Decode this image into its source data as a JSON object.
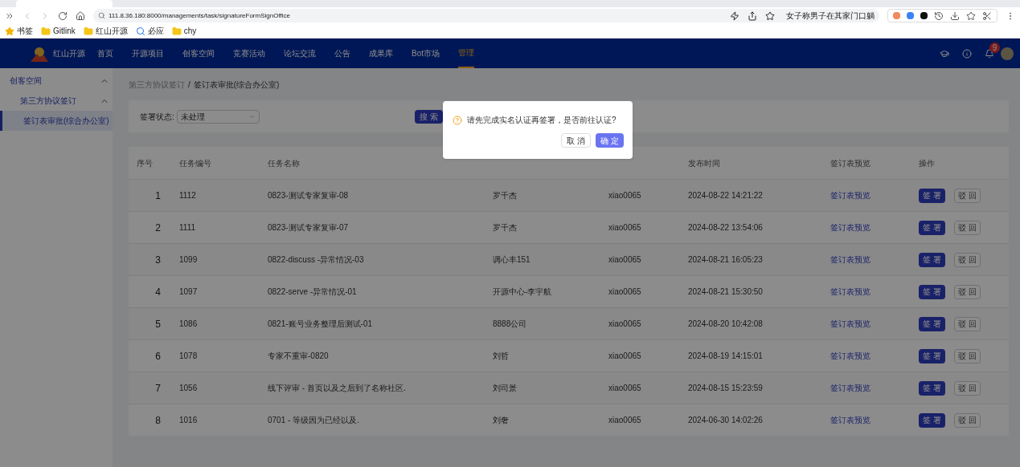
{
  "browser": {
    "url": "111.8.36.180:8000/managements/task/signatureFormSignOffice",
    "search_chip": "女子称男子在其家门口躺",
    "bookmarks": [
      {
        "label": "书签",
        "kind": "star"
      },
      {
        "label": "Gitlink",
        "kind": "folder"
      },
      {
        "label": "红山开源",
        "kind": "folder"
      },
      {
        "label": "必应",
        "kind": "search"
      },
      {
        "label": "chy",
        "kind": "folder"
      }
    ]
  },
  "nav": {
    "logo": "红山开源",
    "items": [
      {
        "label": "首页",
        "selected": false
      },
      {
        "label": "开源项目",
        "selected": false
      },
      {
        "label": "创客空间",
        "selected": false
      },
      {
        "label": "竞赛活动",
        "selected": false
      },
      {
        "label": "论坛交流",
        "selected": false
      },
      {
        "label": "公告",
        "selected": false
      },
      {
        "label": "成果库",
        "selected": false
      },
      {
        "label": "Bot市场",
        "selected": false
      },
      {
        "label": "管理",
        "selected": true
      }
    ],
    "badge": "9"
  },
  "sidebar": {
    "items": [
      {
        "label": "创客空间",
        "expanded": true,
        "children": [
          {
            "label": "第三方协议签订",
            "expanded": true,
            "children": [
              {
                "label": "签订表审批(综合办公室)",
                "selected": true
              }
            ]
          }
        ]
      }
    ]
  },
  "breadcrumb": {
    "parent": "第三方协议签订",
    "separator": "/",
    "current": "签订表审批(综合办公室)"
  },
  "filter": {
    "label": "签署状态:",
    "value": "未处理",
    "button": "搜 索"
  },
  "table": {
    "columns": [
      "序号",
      "任务编号",
      "任务名称",
      "",
      "",
      "发布时间",
      "签订表预览",
      "操作"
    ],
    "rows": [
      {
        "index": "1",
        "id": "1112",
        "name": "0823-测试专家复审-08",
        "owner": "罗千杰",
        "publisher": "xiao0065",
        "time": "2024-08-22 14:21:22",
        "preview": "签订表预览",
        "sign": "签 署",
        "reject": "驳 回"
      },
      {
        "index": "2",
        "id": "1111",
        "name": "0823-测试专家复审-07",
        "owner": "罗千杰",
        "publisher": "xiao0065",
        "time": "2024-08-22 13:54:06",
        "preview": "签订表预览",
        "sign": "签 署",
        "reject": "驳 回"
      },
      {
        "index": "3",
        "id": "1099",
        "name": "0822-discuss -异常情况-03",
        "owner": "调心丰151",
        "publisher": "xiao0065",
        "time": "2024-08-21 16:05:23",
        "preview": "签订表预览",
        "sign": "签 署",
        "reject": "驳 回"
      },
      {
        "index": "4",
        "id": "1097",
        "name": "0822-serve -异常情况-01",
        "owner": "开源中心-李宇航",
        "publisher": "xiao0065",
        "time": "2024-08-21 15:30:50",
        "preview": "签订表预览",
        "sign": "签 署",
        "reject": "驳 回"
      },
      {
        "index": "5",
        "id": "1086",
        "name": "0821-账号业务整理后测试-01",
        "owner": "8888公司",
        "publisher": "xiao0065",
        "time": "2024-08-20 10:42:08",
        "preview": "签订表预览",
        "sign": "签 署",
        "reject": "驳 回"
      },
      {
        "index": "6",
        "id": "1078",
        "name": "专家不重审-0820",
        "owner": "刘哲",
        "publisher": "xiao0065",
        "time": "2024-08-19 14:15:01",
        "preview": "签订表预览",
        "sign": "签 署",
        "reject": "驳 回"
      },
      {
        "index": "7",
        "id": "1056",
        "name": "线下评审 - 首页以及之后到了名称社区.",
        "owner": "刘司景",
        "publisher": "xiao0065",
        "time": "2024-08-15 15:23:59",
        "preview": "签订表预览",
        "sign": "签 署",
        "reject": "驳 回"
      },
      {
        "index": "8",
        "id": "1016",
        "name": "0701 - 等级因为已经以及.",
        "owner": "刘奢",
        "publisher": "xiao0065",
        "time": "2024-06-30 14:02:26",
        "preview": "签订表预览",
        "sign": "签 署",
        "reject": "驳 回"
      }
    ]
  },
  "dialog": {
    "message": "请先完成实名认证再签署，是否前往认证?",
    "cancel": "取 消",
    "confirm": "确 定"
  }
}
